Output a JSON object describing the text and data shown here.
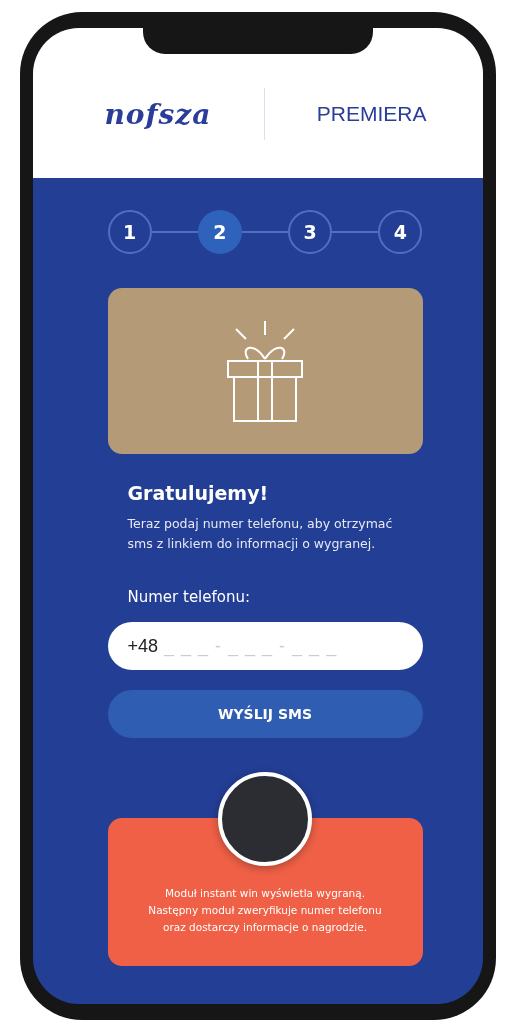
{
  "header": {
    "logo": "nofsza",
    "title": "PREMIERA"
  },
  "steps": [
    {
      "label": "1",
      "selected": false
    },
    {
      "label": "2",
      "selected": true
    },
    {
      "label": "3",
      "selected": false
    },
    {
      "label": "4",
      "selected": false
    }
  ],
  "heading": "Gratulujemy!",
  "description": "Teraz podaj numer telefonu, aby otrzymać sms z linkiem do informacji o wygranej.",
  "phone_field": {
    "label": "Numer telefonu:",
    "value": "+48",
    "placeholder": "_ _ _ - _ _ _ - _ _ _"
  },
  "submit_button": "WYŚLIJ SMS",
  "info_card": {
    "text": "Moduł instant win wyświetla wygraną.\nNastępny moduł zweryfikuje numer telefonu\noraz dostarczy informacje o nagrodzie."
  }
}
